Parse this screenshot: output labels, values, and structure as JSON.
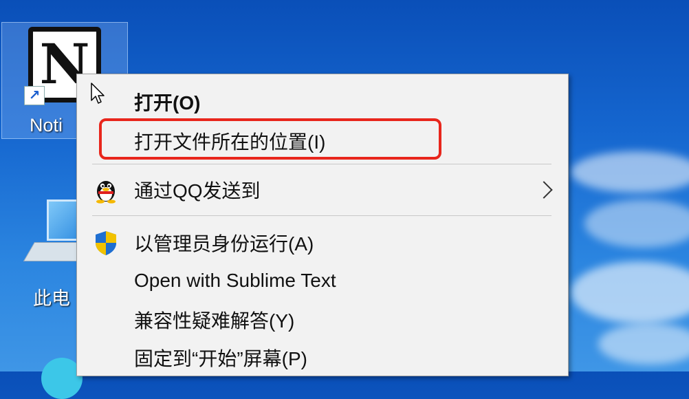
{
  "desktop": {
    "notion_icon_label": "Noti",
    "notion_logo_letter": "N",
    "pc_icon_label": "此电"
  },
  "context_menu": {
    "items": [
      {
        "label": "打开(O)",
        "bold": true
      },
      {
        "label": "打开文件所在的位置(I)",
        "highlighted": true
      },
      {
        "label": "通过QQ发送到",
        "icon": "qq-penguin-icon",
        "has_submenu": true
      },
      {
        "label": "以管理员身份运行(A)",
        "icon": "uac-shield-icon"
      },
      {
        "label": "Open with Sublime Text"
      },
      {
        "label": "兼容性疑难解答(Y)"
      },
      {
        "label": "固定到“开始”屏幕(P)"
      }
    ]
  },
  "colors": {
    "highlight_outline": "#e8261c",
    "menu_background": "#f2f2f2",
    "desktop_blue": "#1566cf"
  }
}
